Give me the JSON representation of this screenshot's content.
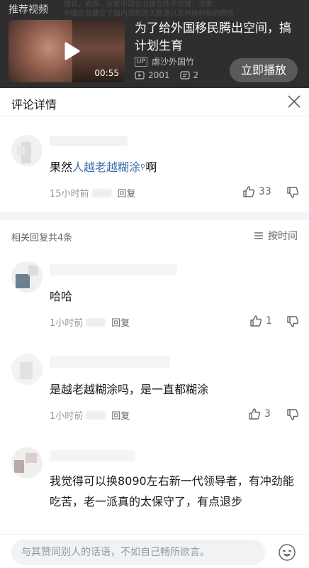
{
  "banner": {
    "label": "推荐视频",
    "bg_lines": [
      "理论，而按，这家中国企业建立技术领域。这家",
      "中国企业建立了国内领先的大数据以及持续创新的网络",
      "…………………………………………………………"
    ],
    "duration": "00:55",
    "title": "为了给外国移民腾出空间，搞计划生育",
    "up_tag": "UP",
    "uploader": "虐沙外国竹",
    "plays": "2001",
    "danmaku": "2",
    "play_now": "立即播放"
  },
  "header": {
    "title": "评论详情"
  },
  "main_comment": {
    "text_prefix": "果然",
    "text_highlight": "人越老越糊涂",
    "text_suffix": "啊",
    "time": "15小时前",
    "reply": "回复",
    "likes": "33"
  },
  "related": {
    "count_label": "相关回复共4条",
    "sort_label": "按时间"
  },
  "replies": [
    {
      "text": "哈哈",
      "time": "1小时前",
      "reply": "回复",
      "likes": "1"
    },
    {
      "text": "是越老越糊涂吗，是一直都糊涂",
      "time": "1小时前",
      "reply": "回复",
      "likes": "3"
    },
    {
      "text": "我觉得可以换8090左右新一代领导者，有冲劲能吃苦，老一派真的太保守了，有点退步"
    }
  ],
  "input": {
    "placeholder": "与其赞同别人的话语，不如自己畅所欲言。"
  },
  "colors": {
    "highlight": "#3b6fa8",
    "meta": "#9499a0",
    "banner_bg": "#2e2e2f"
  }
}
